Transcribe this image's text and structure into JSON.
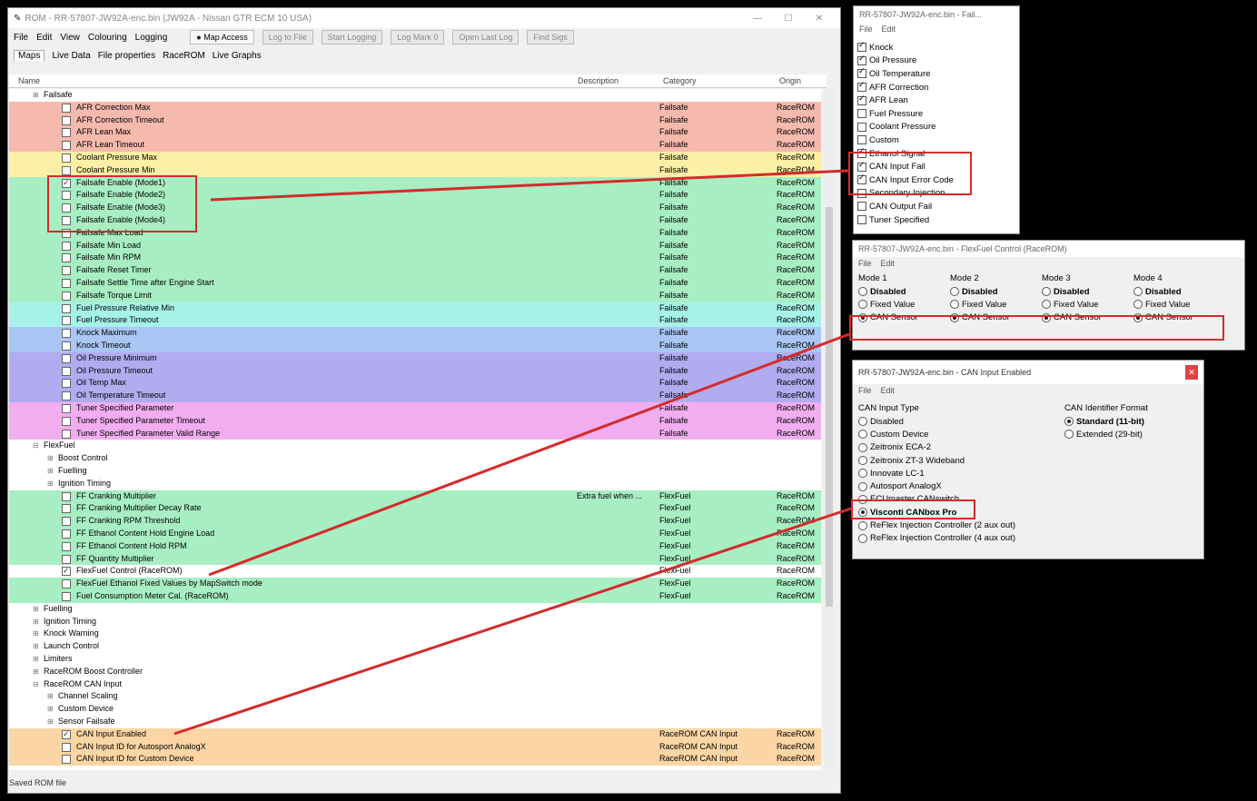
{
  "main": {
    "title": "ROM - RR-57807-JW92A-enc.bin (JW92A - Nissan GTR ECM 10 USA)",
    "menu": [
      "File",
      "Edit",
      "View",
      "Colouring",
      "Logging"
    ],
    "toolbar": [
      "Map Access",
      "Log to File",
      "Start Logging",
      "Log Mark 0",
      "Open Last Log",
      "Find Sigs"
    ],
    "tabs": [
      "Maps",
      "Live Data",
      "File properties",
      "RaceROM",
      "Live Graphs"
    ],
    "columns": {
      "name": "Name",
      "desc": "Description",
      "cat": "Category",
      "orig": "Origin"
    },
    "status": "Saved ROM file"
  },
  "rows": [
    {
      "label": "Failsafe",
      "type": "group",
      "indent": 1,
      "bg": "#ffffff"
    },
    {
      "label": "AFR Correction Max",
      "indent": 2,
      "bg": "#f6b9ae",
      "cat": "Failsafe",
      "orig": "RaceROM"
    },
    {
      "label": "AFR Correction Timeout",
      "indent": 2,
      "bg": "#f6b9ae",
      "cat": "Failsafe",
      "orig": "RaceROM"
    },
    {
      "label": "AFR Lean Max",
      "indent": 2,
      "bg": "#f6b9ae",
      "cat": "Failsafe",
      "orig": "RaceROM"
    },
    {
      "label": "AFR Lean Timeout",
      "indent": 2,
      "bg": "#f6b9ae",
      "cat": "Failsafe",
      "orig": "RaceROM"
    },
    {
      "label": "Coolant Pressure Max",
      "indent": 2,
      "bg": "#fbf0a6",
      "cat": "Failsafe",
      "orig": "RaceROM"
    },
    {
      "label": "Coolant Pressure Min",
      "indent": 2,
      "bg": "#fbf0a6",
      "cat": "Failsafe",
      "orig": "RaceROM"
    },
    {
      "label": "Failsafe Enable (Mode1)",
      "indent": 2,
      "bg": "#a8eec3",
      "cat": "Failsafe",
      "orig": "RaceROM",
      "checked": true
    },
    {
      "label": "Failsafe Enable (Mode2)",
      "indent": 2,
      "bg": "#a8eec3",
      "cat": "Failsafe",
      "orig": "RaceROM"
    },
    {
      "label": "Failsafe Enable (Mode3)",
      "indent": 2,
      "bg": "#a8eec3",
      "cat": "Failsafe",
      "orig": "RaceROM"
    },
    {
      "label": "Failsafe Enable (Mode4)",
      "indent": 2,
      "bg": "#a8eec3",
      "cat": "Failsafe",
      "orig": "RaceROM"
    },
    {
      "label": "Failsafe Max Load",
      "indent": 2,
      "bg": "#a8eec3",
      "cat": "Failsafe",
      "orig": "RaceROM"
    },
    {
      "label": "Failsafe Min Load",
      "indent": 2,
      "bg": "#a8eec3",
      "cat": "Failsafe",
      "orig": "RaceROM"
    },
    {
      "label": "Failsafe Min RPM",
      "indent": 2,
      "bg": "#a8eec3",
      "cat": "Failsafe",
      "orig": "RaceROM"
    },
    {
      "label": "Failsafe Reset Timer",
      "indent": 2,
      "bg": "#a8eec3",
      "cat": "Failsafe",
      "orig": "RaceROM"
    },
    {
      "label": "Failsafe Settle Time after Engine Start",
      "indent": 2,
      "bg": "#a8eec3",
      "cat": "Failsafe",
      "orig": "RaceROM"
    },
    {
      "label": "Failsafe Torque Limit",
      "indent": 2,
      "bg": "#a8eec3",
      "cat": "Failsafe",
      "orig": "RaceROM"
    },
    {
      "label": "Fuel Pressure Relative Min",
      "indent": 2,
      "bg": "#a6f2e8",
      "cat": "Failsafe",
      "orig": "RaceROM"
    },
    {
      "label": "Fuel Pressure Timeout",
      "indent": 2,
      "bg": "#a6f2e8",
      "cat": "Failsafe",
      "orig": "RaceROM"
    },
    {
      "label": "Knock Maximum",
      "indent": 2,
      "bg": "#a9c6f5",
      "cat": "Failsafe",
      "orig": "RaceROM"
    },
    {
      "label": "Knock Timeout",
      "indent": 2,
      "bg": "#a9c6f5",
      "cat": "Failsafe",
      "orig": "RaceROM"
    },
    {
      "label": "Oil Pressure Minimum",
      "indent": 2,
      "bg": "#b1acf0",
      "cat": "Failsafe",
      "orig": "RaceROM"
    },
    {
      "label": "Oil Pressure Timeout",
      "indent": 2,
      "bg": "#b1acf0",
      "cat": "Failsafe",
      "orig": "RaceROM"
    },
    {
      "label": "Oil Temp Max",
      "indent": 2,
      "bg": "#b1acf0",
      "cat": "Failsafe",
      "orig": "RaceROM"
    },
    {
      "label": "Oil Temperature Timeout",
      "indent": 2,
      "bg": "#b1acf0",
      "cat": "Failsafe",
      "orig": "RaceROM"
    },
    {
      "label": "Tuner Specified Parameter",
      "indent": 2,
      "bg": "#f1adf0",
      "cat": "Failsafe",
      "orig": "RaceROM"
    },
    {
      "label": "Tuner Specified Parameter Timeout",
      "indent": 2,
      "bg": "#f1adf0",
      "cat": "Failsafe",
      "orig": "RaceROM"
    },
    {
      "label": "Tuner Specified Parameter Valid Range",
      "indent": 2,
      "bg": "#f1adf0",
      "cat": "Failsafe",
      "orig": "RaceROM"
    },
    {
      "label": "FlexFuel",
      "type": "group",
      "indent": 1,
      "bg": "#ffffff",
      "open": true
    },
    {
      "label": "Boost Control",
      "type": "group",
      "indent": 2,
      "bg": "#ffffff"
    },
    {
      "label": "Fuelling",
      "type": "group",
      "indent": 2,
      "bg": "#ffffff"
    },
    {
      "label": "Ignition Timing",
      "type": "group",
      "indent": 2,
      "bg": "#ffffff"
    },
    {
      "label": "FF Cranking Multiplier",
      "indent": 2,
      "bg": "#a8eec3",
      "desc": "Extra fuel when ...",
      "cat": "FlexFuel",
      "orig": "RaceROM"
    },
    {
      "label": "FF Cranking Multiplier Decay Rate",
      "indent": 2,
      "bg": "#a8eec3",
      "cat": "FlexFuel",
      "orig": "RaceROM"
    },
    {
      "label": "FF Cranking RPM Threshold",
      "indent": 2,
      "bg": "#a8eec3",
      "cat": "FlexFuel",
      "orig": "RaceROM"
    },
    {
      "label": "FF Ethanol Content Hold Engine Load",
      "indent": 2,
      "bg": "#a8eec3",
      "cat": "FlexFuel",
      "orig": "RaceROM"
    },
    {
      "label": "FF Ethanol Content Hold RPM",
      "indent": 2,
      "bg": "#a8eec3",
      "cat": "FlexFuel",
      "orig": "RaceROM"
    },
    {
      "label": "FF Quantity Multiplier",
      "indent": 2,
      "bg": "#a8eec3",
      "cat": "FlexFuel",
      "orig": "RaceROM"
    },
    {
      "label": "FlexFuel Control (RaceROM)",
      "indent": 2,
      "bg": "#ffffff",
      "cat": "FlexFuel",
      "orig": "RaceROM",
      "checked": true
    },
    {
      "label": "FlexFuel Ethanol Fixed Values by MapSwitch mode",
      "indent": 2,
      "bg": "#a8eec3",
      "cat": "FlexFuel",
      "orig": "RaceROM"
    },
    {
      "label": "Fuel Consumption Meter Cal. (RaceROM)",
      "indent": 2,
      "bg": "#a8eec3",
      "cat": "FlexFuel",
      "orig": "RaceROM"
    },
    {
      "label": "Fuelling",
      "type": "group",
      "indent": 1,
      "bg": "#ffffff"
    },
    {
      "label": "Ignition Timing",
      "type": "group",
      "indent": 1,
      "bg": "#ffffff"
    },
    {
      "label": "Knock Warning",
      "type": "group",
      "indent": 1,
      "bg": "#ffffff"
    },
    {
      "label": "Launch Control",
      "type": "group",
      "indent": 1,
      "bg": "#ffffff"
    },
    {
      "label": "Limiters",
      "type": "group",
      "indent": 1,
      "bg": "#ffffff"
    },
    {
      "label": "RaceROM Boost Controller",
      "type": "group",
      "indent": 1,
      "bg": "#ffffff"
    },
    {
      "label": "RaceROM CAN Input",
      "type": "group",
      "indent": 1,
      "bg": "#ffffff",
      "open": true
    },
    {
      "label": "Channel Scaling",
      "type": "group",
      "indent": 2,
      "bg": "#ffffff"
    },
    {
      "label": "Custom Device",
      "type": "group",
      "indent": 2,
      "bg": "#ffffff"
    },
    {
      "label": "Sensor Failsafe",
      "type": "group",
      "indent": 2,
      "bg": "#ffffff"
    },
    {
      "label": "CAN Input Enabled",
      "indent": 2,
      "bg": "#fbd6a4",
      "cat": "RaceROM CAN Input",
      "orig": "RaceROM",
      "checked": true
    },
    {
      "label": "CAN Input ID for Autosport AnalogX",
      "indent": 2,
      "bg": "#fbd6a4",
      "cat": "RaceROM CAN Input",
      "orig": "RaceROM"
    },
    {
      "label": "CAN Input ID for Custom Device",
      "indent": 2,
      "bg": "#fbd6a4",
      "cat": "RaceROM CAN Input",
      "orig": "RaceROM"
    }
  ],
  "failsafe_panel": {
    "title": "RR-57807-JW92A-enc.bin - Fail...",
    "menu": [
      "File",
      "Edit"
    ],
    "items": [
      {
        "label": "Knock",
        "checked": true
      },
      {
        "label": "Oil Pressure",
        "checked": true
      },
      {
        "label": "Oil Temperature",
        "checked": true
      },
      {
        "label": "AFR Correction",
        "checked": true
      },
      {
        "label": "AFR Lean",
        "checked": true
      },
      {
        "label": "Fuel Pressure",
        "checked": false
      },
      {
        "label": "Coolant Pressure",
        "checked": false
      },
      {
        "label": "Custom",
        "checked": false
      },
      {
        "label": "Ethanol Signal",
        "checked": true
      },
      {
        "label": "CAN Input Fail",
        "checked": true
      },
      {
        "label": "CAN Input Error Code",
        "checked": true
      },
      {
        "label": "Secondary Injection",
        "checked": false
      },
      {
        "label": "CAN Output Fail",
        "checked": false
      },
      {
        "label": "Tuner Specified",
        "checked": false
      }
    ]
  },
  "flexfuel_panel": {
    "title": "RR-57807-JW92A-enc.bin - FlexFuel Control (RaceROM)",
    "menu": [
      "File",
      "Edit"
    ],
    "modes": [
      "Mode 1",
      "Mode 2",
      "Mode 3",
      "Mode 4"
    ],
    "options": [
      "Disabled",
      "Fixed Value",
      "CAN Sensor"
    ],
    "selected": "CAN Sensor"
  },
  "can_panel": {
    "title": "RR-57807-JW92A-enc.bin - CAN Input Enabled",
    "menu": [
      "File",
      "Edit"
    ],
    "type_label": "CAN Input Type",
    "types": [
      "Disabled",
      "Custom Device",
      "Zeitronix ECA-2",
      "Zeitronix ZT-3 Wideband",
      "Innovate LC-1",
      "Autosport AnalogX",
      "ECUmaster CANswitch",
      "Visconti CANbox Pro",
      "ReFlex Injection Controller (2 aux out)",
      "ReFlex Injection Controller (4 aux out)"
    ],
    "selected_type": "Visconti CANbox Pro",
    "format_label": "CAN Identifier Format",
    "formats": [
      "Standard (11-bit)",
      "Extended (29-bit)"
    ],
    "selected_format": "Standard (11-bit)",
    "close_color": "#e04343"
  },
  "colors": {
    "highlight": "#d42b2b"
  }
}
